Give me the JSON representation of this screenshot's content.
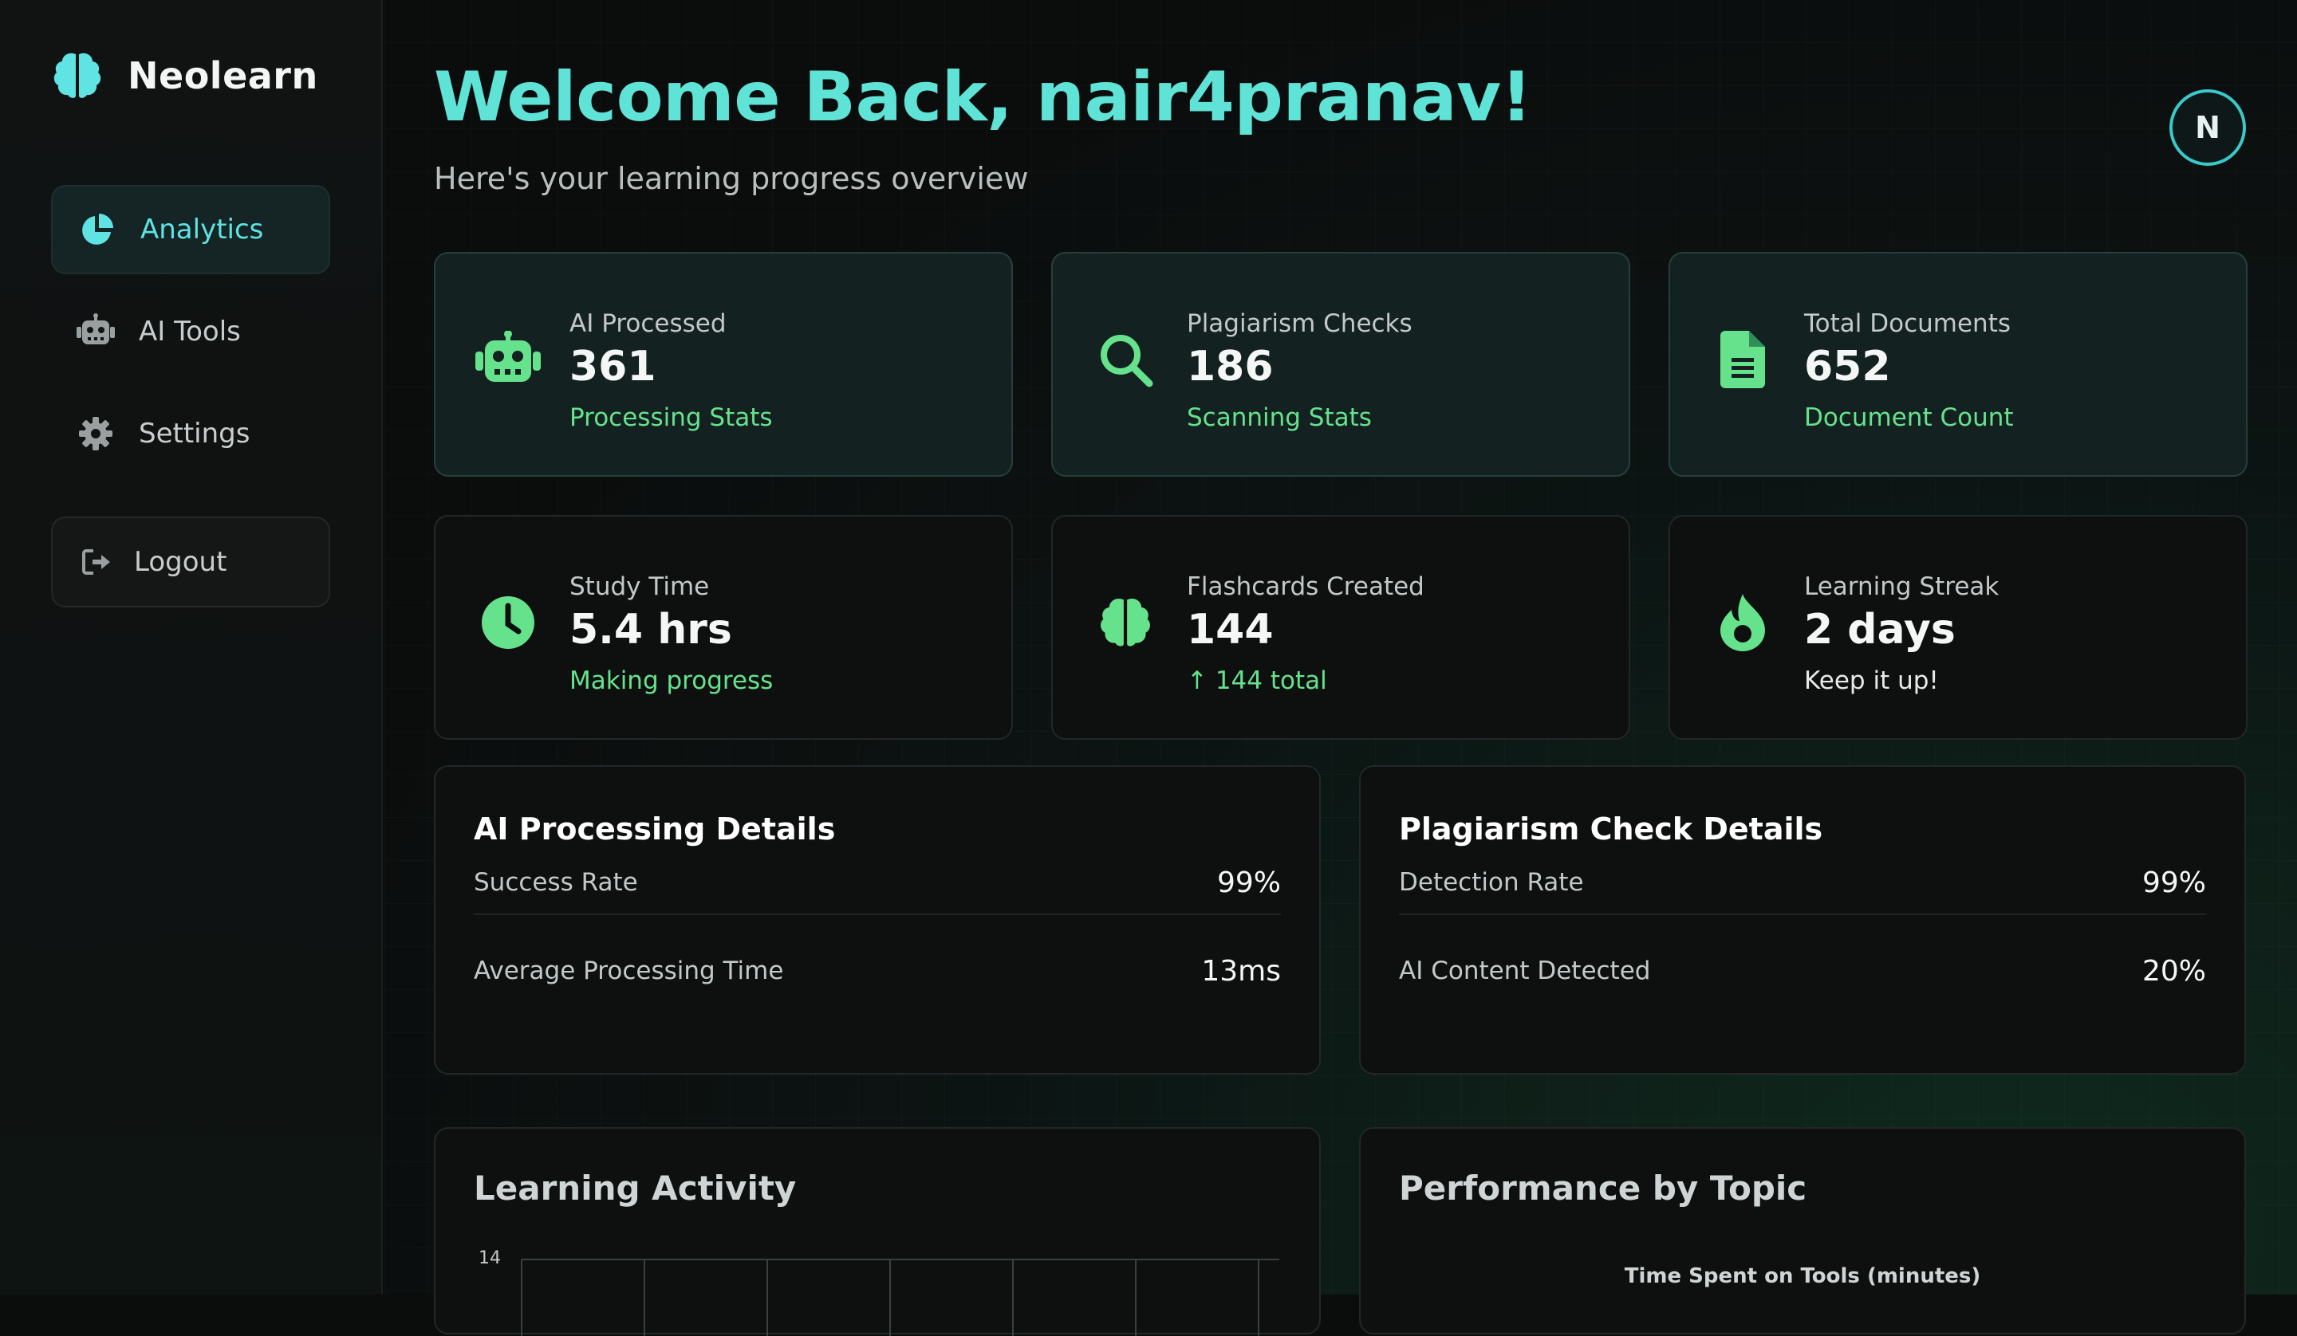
{
  "sidebar": {
    "brand": "Neolearn",
    "items": [
      {
        "label": "Analytics",
        "icon": "pie-chart-icon",
        "active": true
      },
      {
        "label": "AI Tools",
        "icon": "robot-icon"
      },
      {
        "label": "Settings",
        "icon": "gear-icon"
      }
    ],
    "logout_label": "Logout"
  },
  "header": {
    "title": "Welcome Back, nair4pranav!",
    "subtitle": "Here's your learning progress overview",
    "avatar_initial": "N"
  },
  "stats": [
    {
      "label": "AI Processed",
      "value": "361",
      "sub": "Processing Stats",
      "icon": "robot-icon"
    },
    {
      "label": "Plagiarism Checks",
      "value": "186",
      "sub": "Scanning Stats",
      "icon": "search-icon"
    },
    {
      "label": "Total Documents",
      "value": "652",
      "sub": "Document Count",
      "icon": "document-icon"
    },
    {
      "label": "Study Time",
      "value": "5.4 hrs",
      "sub": "Making progress",
      "icon": "clock-icon"
    },
    {
      "label": "Flashcards Created",
      "value": "144",
      "sub": "↑ 144 total",
      "icon": "brain-icon"
    },
    {
      "label": "Learning Streak",
      "value": "2 days",
      "sub": "Keep it up!",
      "icon": "fire-icon"
    }
  ],
  "details": {
    "ai": {
      "title": "AI Processing Details",
      "rows": [
        {
          "label": "Success Rate",
          "value": "99%"
        },
        {
          "label": "Average Processing Time",
          "value": "13ms"
        }
      ]
    },
    "plagiarism": {
      "title": "Plagiarism Check Details",
      "rows": [
        {
          "label": "Detection Rate",
          "value": "99%"
        },
        {
          "label": "AI Content Detected",
          "value": "20%"
        }
      ]
    }
  },
  "panels": {
    "activity": {
      "title": "Learning Activity",
      "y_top_tick": "14"
    },
    "performance": {
      "title": "Performance by Topic",
      "chart_title": "Time Spent on Tools (minutes)"
    }
  },
  "colors": {
    "accent_cyan": "#5fe3d6",
    "accent_green": "#66e28c",
    "background": "#0b0c0c"
  }
}
